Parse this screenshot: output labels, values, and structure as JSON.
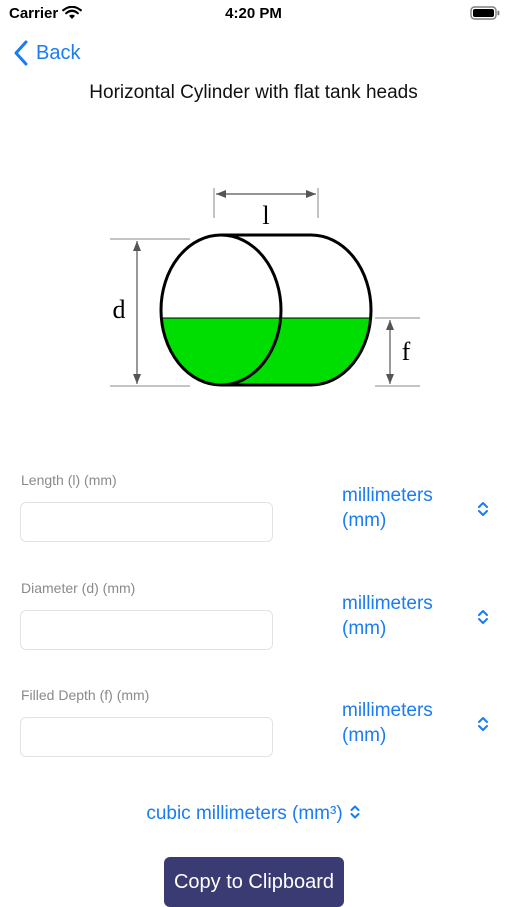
{
  "status_bar": {
    "carrier": "Carrier",
    "time": "4:20 PM",
    "icons": [
      "wifi-icon",
      "battery-icon"
    ]
  },
  "nav": {
    "back_label": "Back",
    "back_icon": "chevron-left-icon",
    "accent_color": "#1a7cf2"
  },
  "title": "Horizontal Cylinder with flat tank heads",
  "diagram": {
    "label_length": "l",
    "label_diameter": "d",
    "label_fill": "f",
    "fill_color": "#00dd00"
  },
  "fields": [
    {
      "label": "Length (l) (mm)",
      "value": "",
      "unit_line1": "millimeters",
      "unit_line2": "(mm)"
    },
    {
      "label": "Diameter (d) (mm)",
      "value": "",
      "unit_line1": "millimeters",
      "unit_line2": "(mm)"
    },
    {
      "label": "Filled Depth (f) (mm)",
      "value": "",
      "unit_line1": "millimeters",
      "unit_line2": "(mm)"
    }
  ],
  "result_unit": "cubic millimeters (mm³)",
  "copy_button": {
    "label": "Copy to Clipboard",
    "color": "#3b3b73"
  }
}
